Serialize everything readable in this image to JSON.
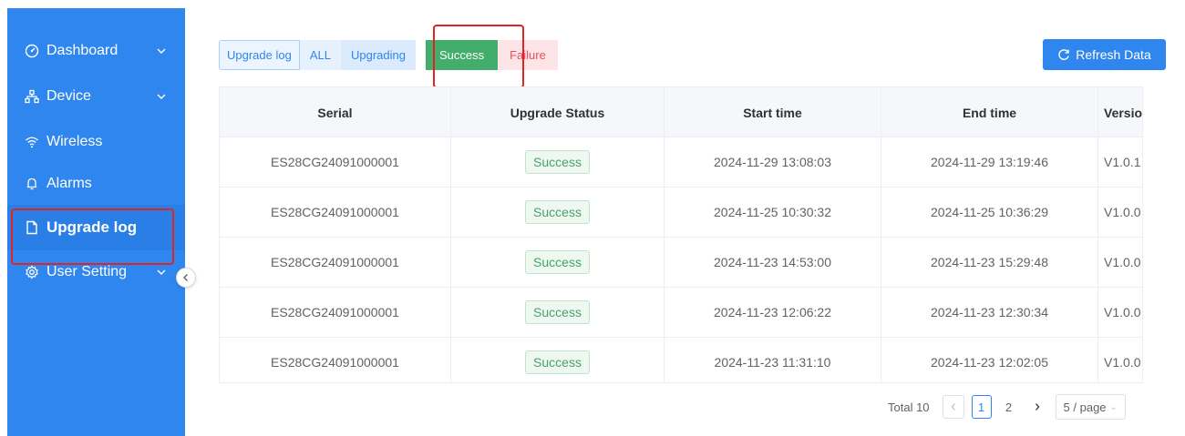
{
  "sidebar": {
    "items": [
      {
        "label": "Dashboard",
        "icon": "dashboard-icon",
        "has_children": true
      },
      {
        "label": "Device",
        "icon": "device-tree-icon",
        "has_children": true
      },
      {
        "label": "Wireless",
        "icon": "wifi-icon",
        "has_children": false
      },
      {
        "label": "Alarms",
        "icon": "bell-icon",
        "has_children": false
      },
      {
        "label": "Upgrade log",
        "icon": "document-icon",
        "has_children": false,
        "active": true
      },
      {
        "label": "User Setting",
        "icon": "gear-icon",
        "has_children": true
      }
    ],
    "collapse_icon": "chevron-left-icon"
  },
  "filters": {
    "upgrade_log": "Upgrade log",
    "all": "ALL",
    "upgrading": "Upgrading",
    "success": "Success",
    "failure": "Failure",
    "selected": "Success"
  },
  "toolbar": {
    "refresh_label": "Refresh Data",
    "refresh_icon": "refresh-icon"
  },
  "table": {
    "columns": [
      "Serial",
      "Upgrade Status",
      "Start time",
      "End time",
      "Version Olc"
    ],
    "rows": [
      {
        "serial": "ES28CG24091000001",
        "status": "Success",
        "start": "2024-11-29 13:08:03",
        "end": "2024-11-29 13:19:46",
        "version": "V1.0.1"
      },
      {
        "serial": "ES28CG24091000001",
        "status": "Success",
        "start": "2024-11-25 10:30:32",
        "end": "2024-11-25 10:36:29",
        "version": "V1.0.0"
      },
      {
        "serial": "ES28CG24091000001",
        "status": "Success",
        "start": "2024-11-23 14:53:00",
        "end": "2024-11-23 15:29:48",
        "version": "V1.0.0"
      },
      {
        "serial": "ES28CG24091000001",
        "status": "Success",
        "start": "2024-11-23 12:06:22",
        "end": "2024-11-23 12:30:34",
        "version": "V1.0.0"
      },
      {
        "serial": "ES28CG24091000001",
        "status": "Success",
        "start": "2024-11-23 11:31:10",
        "end": "2024-11-23 12:02:05",
        "version": "V1.0.0"
      }
    ]
  },
  "pagination": {
    "total": "Total 10",
    "pages": [
      "1",
      "2"
    ],
    "current": "1",
    "page_size": "5 / page"
  },
  "colors": {
    "sidebar_bg": "#2f86ee",
    "success_green": "#43ad6b",
    "failure_red": "#e55060",
    "highlight_red": "#e02424"
  }
}
